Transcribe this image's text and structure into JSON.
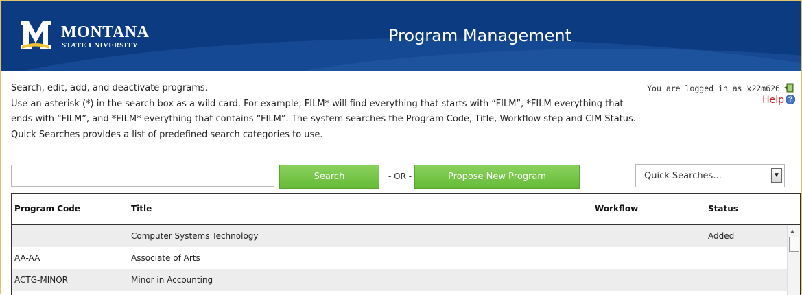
{
  "header": {
    "logo_line1": "MONTANA",
    "logo_line2": "STATE UNIVERSITY",
    "app_title": "Program Management"
  },
  "intro": {
    "line1": "Search, edit, add, and deactivate programs.",
    "line2": "Use an asterisk (*) in the search box as a wild card. For example, FILM* will find everything that starts with “FILM”, *FILM everything that",
    "line3": "ends with “FILM”, and *FILM* everything that contains “FILM”. The system searches the Program Code, Title, Workflow step and CIM Status.",
    "line4": "Quick Searches provides a list of predefined search categories to use."
  },
  "user": {
    "logged_in_text": "You are logged in as x22m626",
    "help_label": "Help"
  },
  "search": {
    "input_value": "",
    "search_label": "Search",
    "or_label": "- OR -",
    "propose_label": "Propose New Program",
    "quick_searches_label": "Quick Searches..."
  },
  "table": {
    "columns": [
      "Program Code",
      "Title",
      "Workflow",
      "Status"
    ],
    "rows": [
      {
        "code": "",
        "title": "Computer Systems Technology",
        "workflow": "",
        "status": "Added"
      },
      {
        "code": "AA-AA",
        "title": "Associate of Arts",
        "workflow": "",
        "status": ""
      },
      {
        "code": "ACTG-MINOR",
        "title": "Minor in Accounting",
        "workflow": "",
        "status": ""
      }
    ]
  },
  "colors": {
    "header_bg": "#0c3b82",
    "button_green": "#66bb37",
    "help_red": "#cc2222",
    "logo_gold": "#f2c230"
  },
  "icons": [
    "msu-logo",
    "exit-door-icon",
    "help-icon",
    "chevron-down-icon",
    "scroll-up-icon"
  ]
}
